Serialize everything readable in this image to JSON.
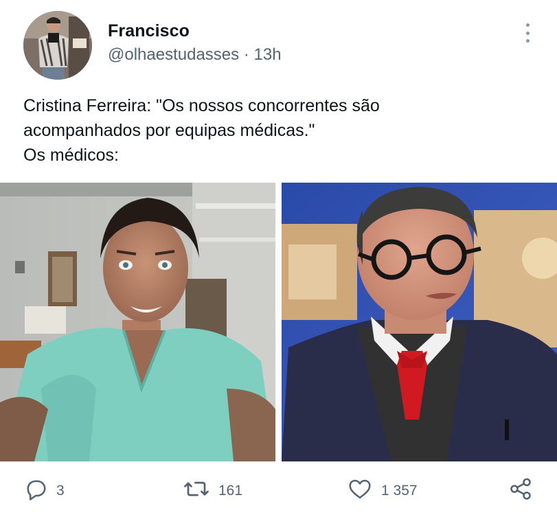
{
  "author": {
    "name": "Francisco",
    "handle": "@olhaestudasses",
    "separator": "·",
    "time": "13h"
  },
  "tweet": {
    "lines": [
      "Cristina Ferreira: \"Os nossos concorrentes são",
      "acompanhados por equipas médicas.\"",
      "Os médicos:"
    ]
  },
  "media": [
    {
      "icon": "photo-man-in-scrubs-selfie"
    },
    {
      "icon": "photo-man-with-glasses-red-tie"
    }
  ],
  "actions": {
    "reply": {
      "icon": "reply-icon",
      "count": "3"
    },
    "retweet": {
      "icon": "retweet-icon",
      "count": "161"
    },
    "like": {
      "icon": "heart-icon",
      "count": "1 357"
    },
    "share": {
      "icon": "share-icon"
    }
  },
  "colors": {
    "text": "#0f1419",
    "secondary": "#536471",
    "background": "#ffffff"
  }
}
